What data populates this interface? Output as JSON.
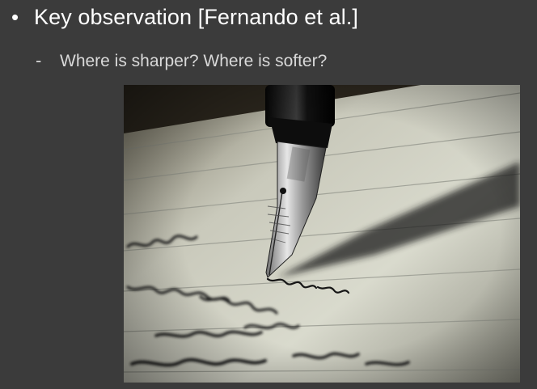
{
  "slide": {
    "bullet": {
      "marker": "•",
      "text": "Key observation [Fernando et al.]"
    },
    "sub_bullet": {
      "marker": "-",
      "text": "Where is sharper? Where is softer?"
    },
    "image": {
      "subject_icon": "fountain-pen-writing-photo",
      "paper_color": "#d8d9cc",
      "ink_color": "#1a1a1a"
    },
    "caption": ""
  }
}
